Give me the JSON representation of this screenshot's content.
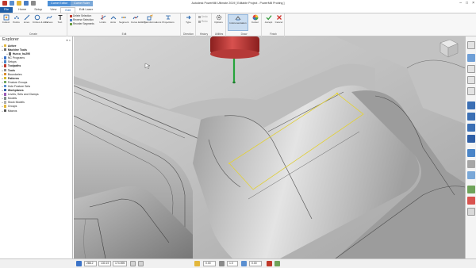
{
  "app": {
    "title": "Autodesk PowerMill Ultimate 2019   [ Editable Project - PowerMill Probing ]",
    "context_tabs": [
      "Curve Editor",
      "Curve Ruler"
    ],
    "window_controls": [
      "–",
      "□",
      "×"
    ]
  },
  "tabs": [
    "File",
    "Home",
    "Setup",
    "View",
    "Edit",
    "Edit Laser"
  ],
  "active_tab": "Edit",
  "ribbon": {
    "create_group": {
      "label": "Create",
      "buttons": [
        "Collect",
        "Points",
        "Lines",
        "Circles & Arcs",
        "Curves",
        "Text"
      ]
    },
    "edit_group": {
      "label": "Edit",
      "small_buttons": [
        "Delete Selection",
        "Reverse Selection",
        "Reorder Segments"
      ],
      "buttons": [
        "Limits",
        "Joins",
        "Segment",
        "Curve Editing",
        "Transformations",
        "Projections"
      ]
    },
    "direction_group": {
      "label": "Direction",
      "button": "Type"
    },
    "history_group": {
      "label": "History",
      "items": [
        "Undo",
        "Redo"
      ]
    },
    "utilities_group": {
      "label": "Utilities",
      "button": "Options"
    },
    "draw_group": {
      "label": "Draw",
      "buttons": [
        "Instrumentation",
        "Colour"
      ]
    },
    "finish_group": {
      "label": "Finish",
      "buttons": [
        "Accept",
        "Cancel"
      ]
    }
  },
  "explorer": {
    "title": "Explorer",
    "items": [
      {
        "label": "Active",
        "level": 0,
        "bold": true,
        "icon": "folder-icon"
      },
      {
        "label": "Machine Tools",
        "level": 0,
        "bold": true,
        "icon": "machine-icon"
      },
      {
        "label": "Hurco_hu290",
        "level": 1,
        "bold": true,
        "icon": "machine-icon"
      },
      {
        "label": "NC Programs",
        "level": 0,
        "bold": false,
        "icon": "program-icon"
      },
      {
        "label": "Setups",
        "level": 0,
        "bold": false,
        "icon": "setup-icon"
      },
      {
        "label": "Toolpaths",
        "level": 0,
        "bold": true,
        "icon": "toolpath-icon"
      },
      {
        "label": "Tools",
        "level": 0,
        "bold": true,
        "icon": "tool-icon"
      },
      {
        "label": "Boundaries",
        "level": 0,
        "bold": false,
        "icon": "boundary-icon"
      },
      {
        "label": "Patterns",
        "level": 0,
        "bold": true,
        "icon": "pattern-icon"
      },
      {
        "label": "Feature Groups",
        "level": 0,
        "bold": false,
        "icon": "feature-icon"
      },
      {
        "label": "Hole Feature Sets",
        "level": 0,
        "bold": false,
        "icon": "hole-icon"
      },
      {
        "label": "Workplanes",
        "level": 0,
        "bold": true,
        "icon": "workplane-icon"
      },
      {
        "label": "Levels, Sets and Clamps",
        "level": 0,
        "bold": false,
        "icon": "levels-icon"
      },
      {
        "label": "Models",
        "level": 0,
        "bold": false,
        "icon": "model-icon"
      },
      {
        "label": "Stock Models",
        "level": 0,
        "bold": false,
        "icon": "stock-icon"
      },
      {
        "label": "Groups",
        "level": 0,
        "bold": false,
        "icon": "group-icon"
      },
      {
        "label": "Macros",
        "level": 0,
        "bold": false,
        "icon": "macro-icon"
      }
    ]
  },
  "status": {
    "x": "288.2",
    "y": "130.19",
    "z": "174.595",
    "fields": [
      "0.00",
      "1.0",
      "0.00"
    ]
  },
  "colors": {
    "accent": "#1f5fa8",
    "context_editor": "#4c8fd6",
    "context_ruler": "#7aa8d8",
    "pattern_line": "#e8d63a",
    "tool_red": "#c8302e",
    "axis_green": "#26a43b"
  }
}
